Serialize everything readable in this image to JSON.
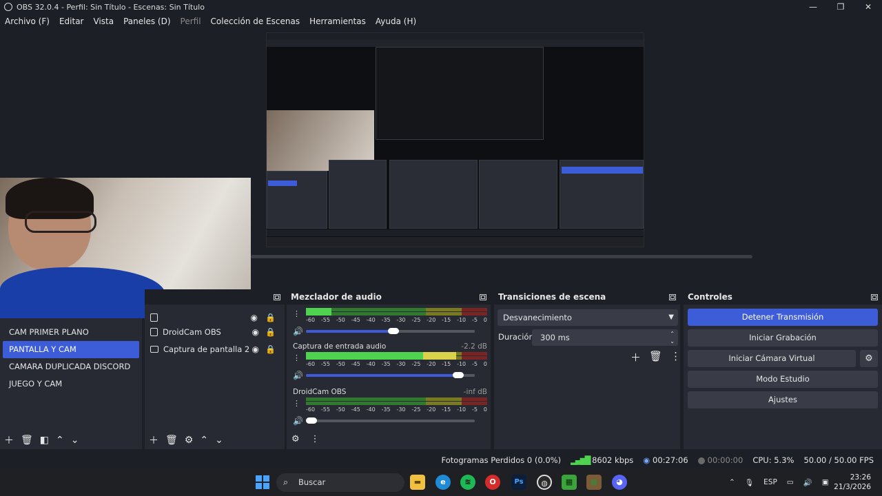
{
  "window": {
    "title": "OBS 32.0.4 - Perfil: Sin Título - Escenas: Sin Título",
    "controls": [
      "—",
      "❐",
      "✕"
    ]
  },
  "menu": [
    "Archivo (F)",
    "Editar",
    "Vista",
    "Paneles (D)",
    "Perfil",
    "Colección de Escenas",
    "Herramientas",
    "Ayuda (H)"
  ],
  "scenes": {
    "items": [
      "CAM PRIMER PLANO",
      "PANTALLA Y CAM",
      "CAMARA DUPLICADA DISCORD",
      "JUEGO Y CAM"
    ],
    "active_index": 1
  },
  "sources": {
    "items": [
      "DroidCam OBS",
      "Captura de pantalla 2"
    ]
  },
  "audio_mixer": {
    "title": "Mezclador de audio",
    "scale": [
      "-60",
      "-55",
      "-50",
      "-45",
      "-40",
      "-35",
      "-30",
      "-25",
      "-20",
      "-15",
      "-10",
      "-5",
      "0"
    ],
    "channels": [
      {
        "name": "",
        "db": "",
        "level": 0.14,
        "volume": 0.52,
        "muted": false
      },
      {
        "name": "Captura de entrada audio",
        "db": "-2.2 dB",
        "level": 0.83,
        "volume": 0.9,
        "muted": false
      },
      {
        "name": "DroidCam OBS",
        "db": "-inf dB",
        "level": 0.0,
        "volume": 0.04,
        "muted": true
      }
    ]
  },
  "transitions": {
    "title": "Transiciones de escena",
    "selected": "Desvanecimiento",
    "duration_label": "Duración",
    "duration_value": "300 ms"
  },
  "controls": {
    "title": "Controles",
    "buttons": [
      "Detener Transmisión",
      "Iniciar Grabación",
      "Iniciar Cámara Virtual",
      "Modo Estudio",
      "Ajustes"
    ]
  },
  "status": {
    "dropped_frames": "Fotogramas Perdidos 0 (0.0%)",
    "bitrate": "8602 kbps",
    "stream_time": "00:27:06",
    "rec_time": "00:00:00",
    "cpu": "CPU: 5.3%",
    "fps": "50.00 / 50.00 FPS"
  },
  "taskbar": {
    "search_placeholder": "Buscar",
    "language": "ESP",
    "time": "23:26",
    "date": "21/3/2026"
  },
  "colors": {
    "accent": "#3c5cd8",
    "background": "#1d1f26",
    "panel": "#272a33"
  }
}
